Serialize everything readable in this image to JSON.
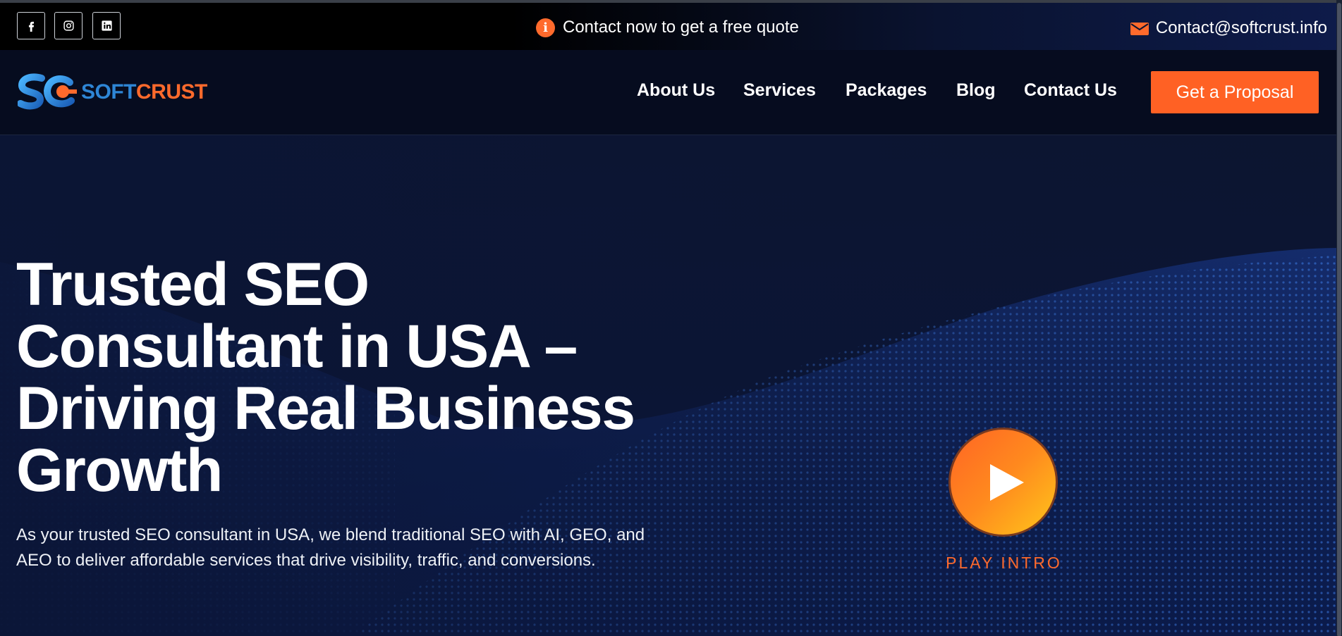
{
  "topbar": {
    "social": [
      {
        "name": "facebook-icon",
        "glyph": "f"
      },
      {
        "name": "instagram-icon",
        "glyph": "ig"
      },
      {
        "name": "linkedin-icon",
        "glyph": "in"
      }
    ],
    "promo_text": "Contact now to get a free quote",
    "promo_icon": "info-icon",
    "email_icon": "envelope-icon",
    "email": "Contact@softcrust.info"
  },
  "navbar": {
    "logo_part1": "SOFT",
    "logo_part2": "CRUST",
    "links": [
      "About Us",
      "Services",
      "Packages",
      "Blog",
      "Contact Us"
    ],
    "cta_label": "Get a Proposal"
  },
  "hero": {
    "headline_lines": [
      "Trusted SEO",
      "Consultant in USA –",
      "Driving Real Business",
      "Growth"
    ],
    "subtext": "As your trusted SEO consultant in USA, we blend traditional SEO with AI, GEO, and AEO to deliver affordable services that drive visibility, traffic, and conversions.",
    "play_label": "PLAY INTRO",
    "play_icon": "play-icon"
  },
  "colors": {
    "accent": "#ff6124",
    "background": "#0a1228",
    "brand_blue": "#2e86d6"
  }
}
